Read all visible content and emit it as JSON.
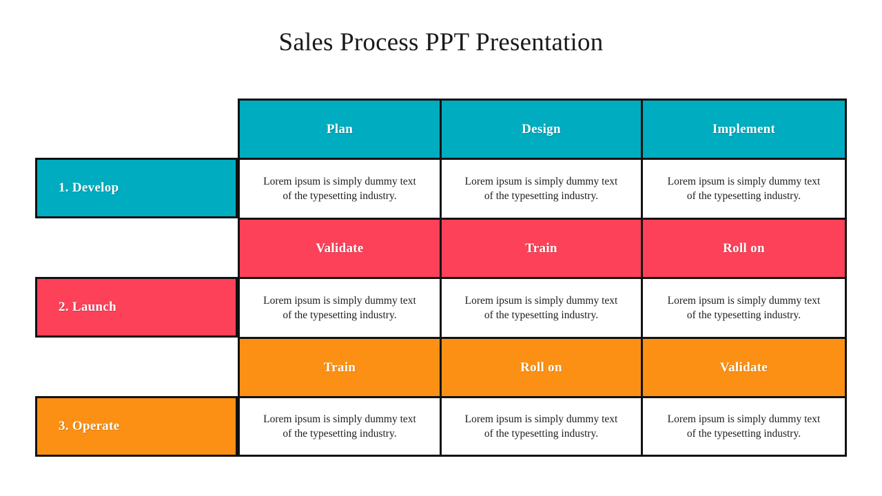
{
  "slide": {
    "title": "Sales Process PPT Presentation",
    "background": "#ffffff"
  },
  "colors": {
    "teal": "#00acbf",
    "pink": "#fc4159",
    "orange": "#fb9015",
    "border": "#111111",
    "text_dark": "#1c1c1c",
    "text_light": "#ffffff"
  },
  "matrix": {
    "body_text": "Lorem ipsum is simply dummy text of the typesetting industry.",
    "stages": [
      {
        "label": "1. Develop",
        "color": "#00acbf",
        "headers": [
          "Plan",
          "Design",
          "Implement"
        ],
        "cells": [
          "Lorem ipsum is simply dummy text of the typesetting industry.",
          "Lorem ipsum is simply dummy text of the typesetting industry.",
          "Lorem ipsum is simply dummy text of the typesetting industry."
        ]
      },
      {
        "label": "2. Launch",
        "color": "#fc4159",
        "headers": [
          "Validate",
          "Train",
          "Roll on"
        ],
        "cells": [
          "Lorem ipsum is simply dummy text of the typesetting industry.",
          "Lorem ipsum is simply dummy text of the typesetting industry.",
          "Lorem ipsum is simply dummy text of the typesetting industry."
        ]
      },
      {
        "label": "3. Operate",
        "color": "#fb9015",
        "headers": [
          "Train",
          "Roll on",
          "Validate"
        ],
        "cells": [
          "Lorem ipsum is simply dummy text of the typesetting industry.",
          "Lorem ipsum is simply dummy text of the typesetting industry.",
          "Lorem ipsum is simply dummy text of the typesetting industry."
        ]
      }
    ]
  }
}
